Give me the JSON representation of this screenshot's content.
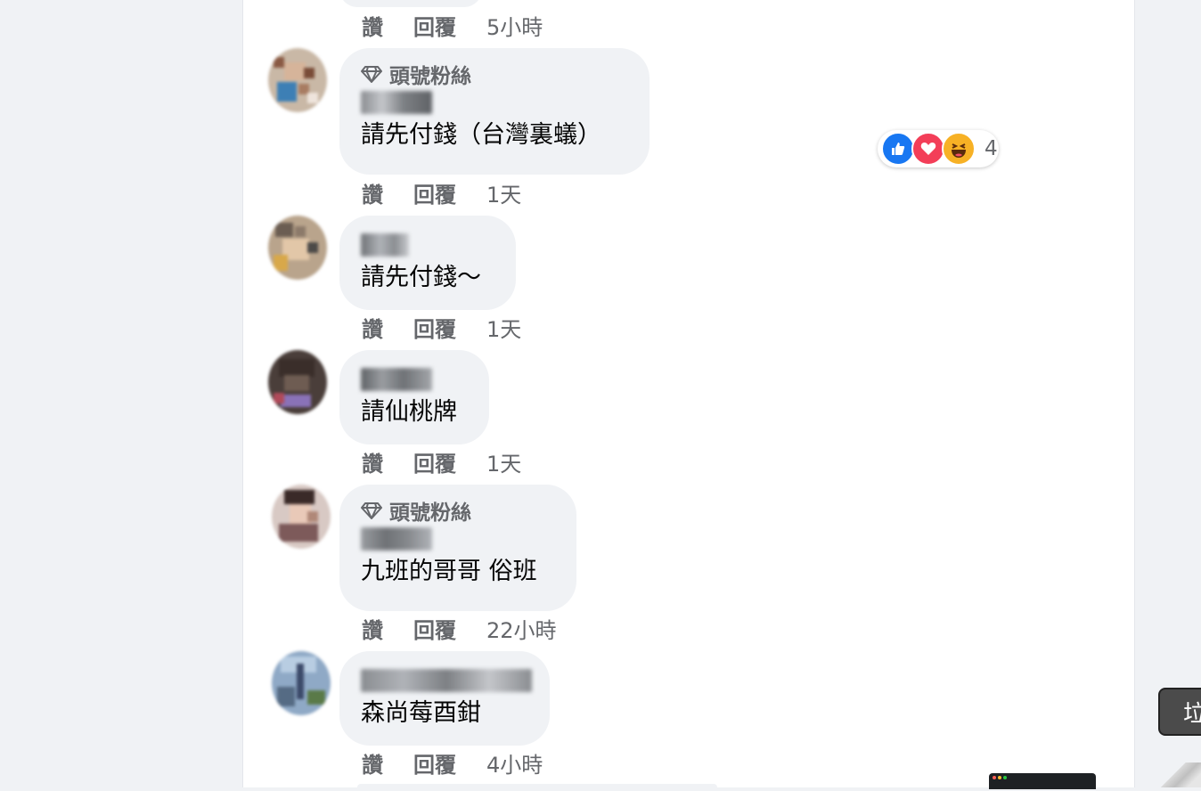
{
  "labels": {
    "like": "讚",
    "reply": "回覆",
    "top_fan": "頭號粉絲"
  },
  "top_actions": {
    "time": "5小時"
  },
  "comments": [
    {
      "top_fan": true,
      "text": "請先付錢（台灣裏蟻）",
      "time": "1天",
      "reactions": {
        "icons": [
          "like-icon",
          "love-icon",
          "haha-icon"
        ],
        "count": "4"
      }
    },
    {
      "top_fan": false,
      "text": "請先付錢～",
      "time": "1天"
    },
    {
      "top_fan": false,
      "text": "請仙桃牌",
      "time": "1天"
    },
    {
      "top_fan": true,
      "text": "九班的哥哥 俗班",
      "time": "22小時"
    },
    {
      "top_fan": false,
      "text": "森尚莓酉鉗",
      "time": "4小時"
    }
  ],
  "floating_button": {
    "label": "垃"
  },
  "colors": {
    "page_bg": "#f0f2f5",
    "bubble_bg": "#f0f2f5",
    "secondary_text": "#65676b",
    "like_blue": "#1877f2",
    "love_red": "#f33e58",
    "haha_yellow": "#f7b125"
  }
}
